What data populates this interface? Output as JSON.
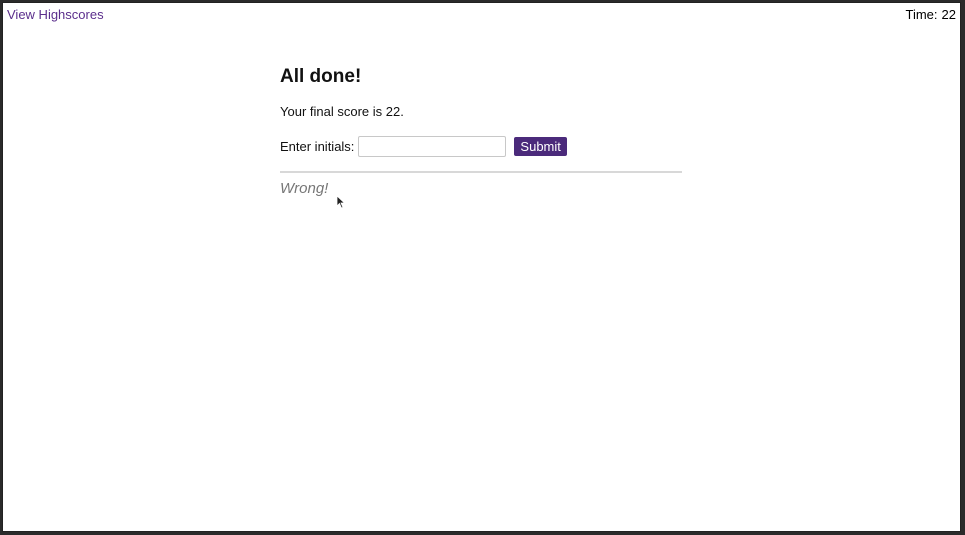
{
  "header": {
    "highscores_link": "View Highscores",
    "timer_label": "Time:",
    "timer_value": "22"
  },
  "main": {
    "title": "All done!",
    "score_text": "Your final score is 22.",
    "initials_label": "Enter initials:",
    "initials_value": "",
    "submit_label": "Submit",
    "feedback": "Wrong!"
  },
  "colors": {
    "link": "#5b2e8c",
    "button": "#4b2a7b"
  },
  "icons": {
    "cursor": "mouse-pointer-icon"
  }
}
